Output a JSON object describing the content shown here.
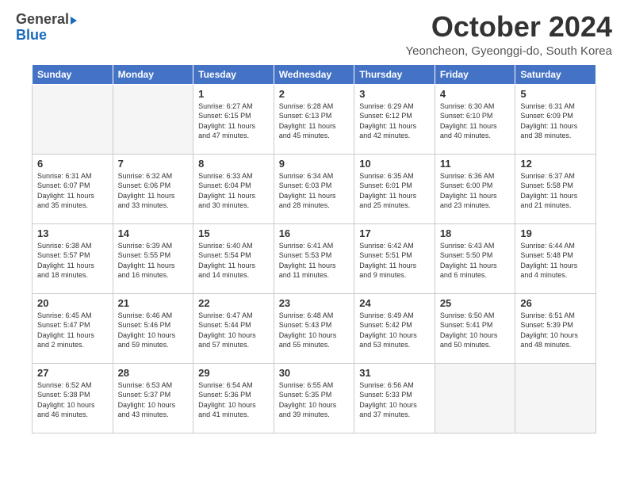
{
  "header": {
    "logo_general": "General",
    "logo_blue": "Blue",
    "month_title": "October 2024",
    "location": "Yeoncheon, Gyeonggi-do, South Korea"
  },
  "days_of_week": [
    "Sunday",
    "Monday",
    "Tuesday",
    "Wednesday",
    "Thursday",
    "Friday",
    "Saturday"
  ],
  "weeks": [
    [
      {
        "day": "",
        "info": ""
      },
      {
        "day": "",
        "info": ""
      },
      {
        "day": "1",
        "info": "Sunrise: 6:27 AM\nSunset: 6:15 PM\nDaylight: 11 hours and 47 minutes."
      },
      {
        "day": "2",
        "info": "Sunrise: 6:28 AM\nSunset: 6:13 PM\nDaylight: 11 hours and 45 minutes."
      },
      {
        "day": "3",
        "info": "Sunrise: 6:29 AM\nSunset: 6:12 PM\nDaylight: 11 hours and 42 minutes."
      },
      {
        "day": "4",
        "info": "Sunrise: 6:30 AM\nSunset: 6:10 PM\nDaylight: 11 hours and 40 minutes."
      },
      {
        "day": "5",
        "info": "Sunrise: 6:31 AM\nSunset: 6:09 PM\nDaylight: 11 hours and 38 minutes."
      }
    ],
    [
      {
        "day": "6",
        "info": "Sunrise: 6:31 AM\nSunset: 6:07 PM\nDaylight: 11 hours and 35 minutes."
      },
      {
        "day": "7",
        "info": "Sunrise: 6:32 AM\nSunset: 6:06 PM\nDaylight: 11 hours and 33 minutes."
      },
      {
        "day": "8",
        "info": "Sunrise: 6:33 AM\nSunset: 6:04 PM\nDaylight: 11 hours and 30 minutes."
      },
      {
        "day": "9",
        "info": "Sunrise: 6:34 AM\nSunset: 6:03 PM\nDaylight: 11 hours and 28 minutes."
      },
      {
        "day": "10",
        "info": "Sunrise: 6:35 AM\nSunset: 6:01 PM\nDaylight: 11 hours and 25 minutes."
      },
      {
        "day": "11",
        "info": "Sunrise: 6:36 AM\nSunset: 6:00 PM\nDaylight: 11 hours and 23 minutes."
      },
      {
        "day": "12",
        "info": "Sunrise: 6:37 AM\nSunset: 5:58 PM\nDaylight: 11 hours and 21 minutes."
      }
    ],
    [
      {
        "day": "13",
        "info": "Sunrise: 6:38 AM\nSunset: 5:57 PM\nDaylight: 11 hours and 18 minutes."
      },
      {
        "day": "14",
        "info": "Sunrise: 6:39 AM\nSunset: 5:55 PM\nDaylight: 11 hours and 16 minutes."
      },
      {
        "day": "15",
        "info": "Sunrise: 6:40 AM\nSunset: 5:54 PM\nDaylight: 11 hours and 14 minutes."
      },
      {
        "day": "16",
        "info": "Sunrise: 6:41 AM\nSunset: 5:53 PM\nDaylight: 11 hours and 11 minutes."
      },
      {
        "day": "17",
        "info": "Sunrise: 6:42 AM\nSunset: 5:51 PM\nDaylight: 11 hours and 9 minutes."
      },
      {
        "day": "18",
        "info": "Sunrise: 6:43 AM\nSunset: 5:50 PM\nDaylight: 11 hours and 6 minutes."
      },
      {
        "day": "19",
        "info": "Sunrise: 6:44 AM\nSunset: 5:48 PM\nDaylight: 11 hours and 4 minutes."
      }
    ],
    [
      {
        "day": "20",
        "info": "Sunrise: 6:45 AM\nSunset: 5:47 PM\nDaylight: 11 hours and 2 minutes."
      },
      {
        "day": "21",
        "info": "Sunrise: 6:46 AM\nSunset: 5:46 PM\nDaylight: 10 hours and 59 minutes."
      },
      {
        "day": "22",
        "info": "Sunrise: 6:47 AM\nSunset: 5:44 PM\nDaylight: 10 hours and 57 minutes."
      },
      {
        "day": "23",
        "info": "Sunrise: 6:48 AM\nSunset: 5:43 PM\nDaylight: 10 hours and 55 minutes."
      },
      {
        "day": "24",
        "info": "Sunrise: 6:49 AM\nSunset: 5:42 PM\nDaylight: 10 hours and 53 minutes."
      },
      {
        "day": "25",
        "info": "Sunrise: 6:50 AM\nSunset: 5:41 PM\nDaylight: 10 hours and 50 minutes."
      },
      {
        "day": "26",
        "info": "Sunrise: 6:51 AM\nSunset: 5:39 PM\nDaylight: 10 hours and 48 minutes."
      }
    ],
    [
      {
        "day": "27",
        "info": "Sunrise: 6:52 AM\nSunset: 5:38 PM\nDaylight: 10 hours and 46 minutes."
      },
      {
        "day": "28",
        "info": "Sunrise: 6:53 AM\nSunset: 5:37 PM\nDaylight: 10 hours and 43 minutes."
      },
      {
        "day": "29",
        "info": "Sunrise: 6:54 AM\nSunset: 5:36 PM\nDaylight: 10 hours and 41 minutes."
      },
      {
        "day": "30",
        "info": "Sunrise: 6:55 AM\nSunset: 5:35 PM\nDaylight: 10 hours and 39 minutes."
      },
      {
        "day": "31",
        "info": "Sunrise: 6:56 AM\nSunset: 5:33 PM\nDaylight: 10 hours and 37 minutes."
      },
      {
        "day": "",
        "info": ""
      },
      {
        "day": "",
        "info": ""
      }
    ]
  ]
}
